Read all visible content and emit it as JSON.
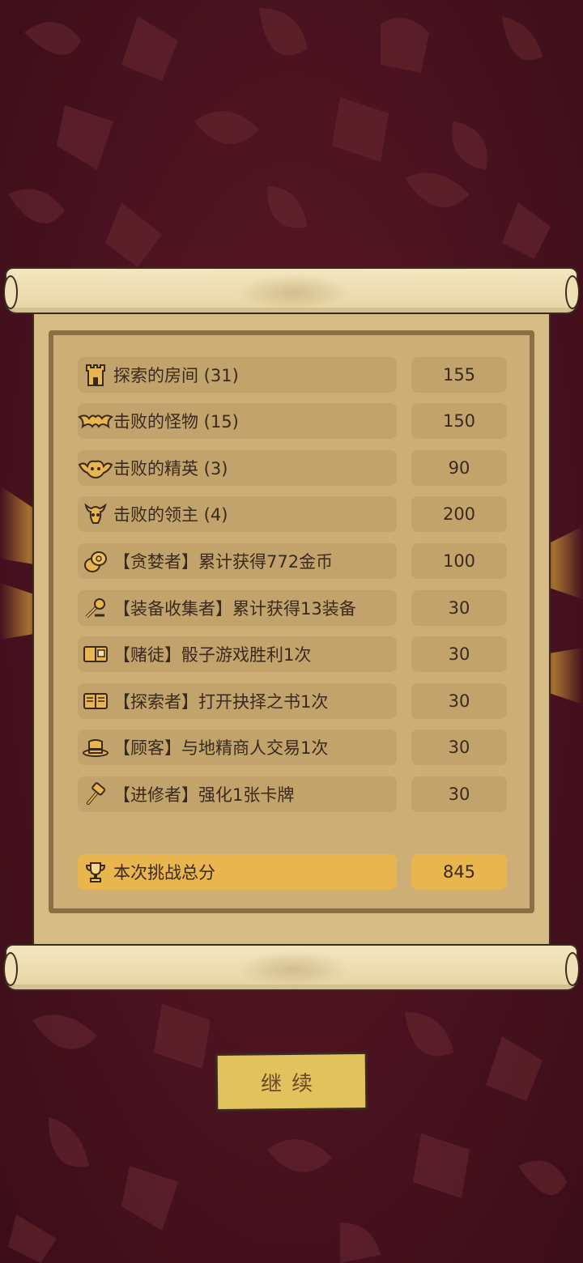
{
  "rows": [
    {
      "icon": "tower-icon",
      "label": "探索的房间 (31)",
      "score": "155"
    },
    {
      "icon": "bat-icon",
      "label": "击败的怪物 (15)",
      "score": "150"
    },
    {
      "icon": "demon-bat-icon",
      "label": "击败的精英 (3)",
      "score": "90"
    },
    {
      "icon": "horned-skull-icon",
      "label": "击败的领主 (4)",
      "score": "200"
    },
    {
      "icon": "gold-coins-icon",
      "label": "【贪婪者】累计获得772金币",
      "score": "100"
    },
    {
      "icon": "equipment-icon",
      "label": "【装备收集者】累计获得13装备",
      "score": "30"
    },
    {
      "icon": "dice-book-icon",
      "label": "【赌徒】骰子游戏胜利1次",
      "score": "30"
    },
    {
      "icon": "book-icon",
      "label": "【探索者】打开抉择之书1次",
      "score": "30"
    },
    {
      "icon": "top-hat-icon",
      "label": "【顾客】与地精商人交易1次",
      "score": "30"
    },
    {
      "icon": "hammer-icon",
      "label": "【进修者】强化1张卡牌",
      "score": "30"
    }
  ],
  "total": {
    "icon": "trophy-icon",
    "label": "本次挑战总分",
    "score": "845"
  },
  "continue_label": "继续",
  "colors": {
    "background": "#4a1220",
    "paper": "#d7bc85",
    "row": "#c2a36b",
    "total_row": "#e8b54e",
    "button": "#e2c25c",
    "text": "#3a2a1e"
  }
}
